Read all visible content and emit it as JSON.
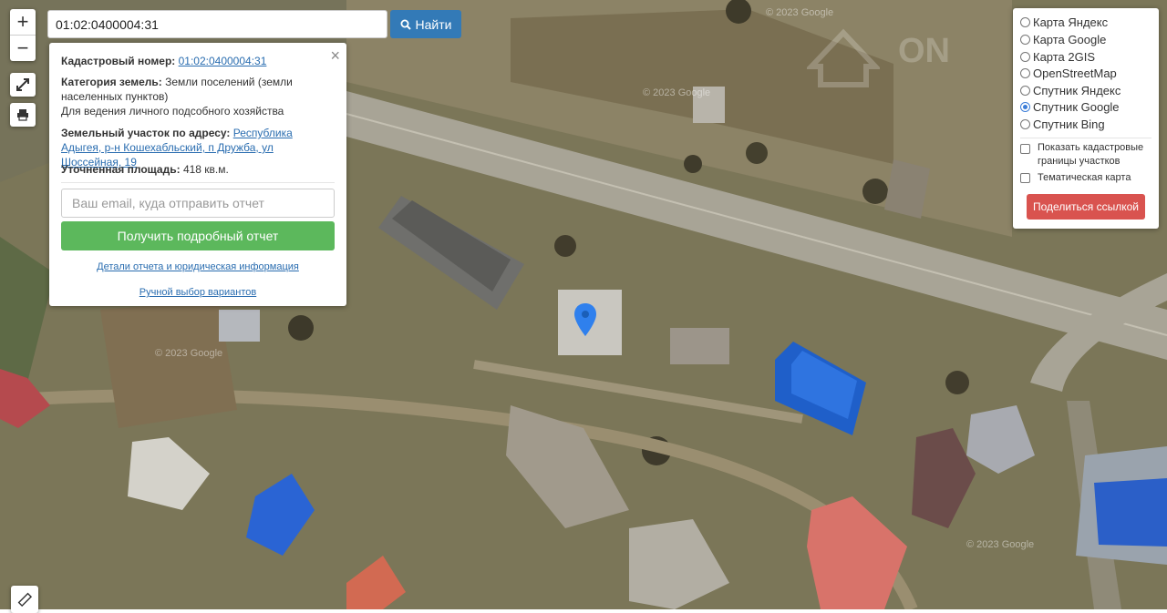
{
  "search": {
    "value": "01:02:0400004:31",
    "button_label": "Найти"
  },
  "map_controls": {
    "zoom_in": "+",
    "zoom_out": "−"
  },
  "info": {
    "cadastral_label": "Кадастровый номер:",
    "cadastral_value": "01:02:0400004:31",
    "category_label": "Категория земель:",
    "category_value": "Земли поселений (земли населенных пунктов)",
    "usage": "Для ведения личного подсобного хозяйства",
    "address_label": "Земельный участок по адресу:",
    "address_value": "Республика Адыгея, р-н Кошехабльский, п Дружба, ул Шоссейная, 19",
    "area_label": "Уточненная площадь:",
    "area_value": "418 кв.м.",
    "email_placeholder": "Ваш email, куда отправить отчет",
    "report_button": "Получить подробный отчет",
    "details_link": "Детали отчета и юридическая информация",
    "manual_link": "Ручной выбор вариантов",
    "close": "×"
  },
  "layers": {
    "options": [
      {
        "label": "Карта Яндекс",
        "selected": false
      },
      {
        "label": "Карта Google",
        "selected": false
      },
      {
        "label": "Карта 2GIS",
        "selected": false
      },
      {
        "label": "OpenStreetMap",
        "selected": false
      },
      {
        "label": "Спутник Яндекс",
        "selected": false
      },
      {
        "label": "Спутник Google",
        "selected": true
      },
      {
        "label": "Спутник Bing",
        "selected": false
      }
    ],
    "show_cadastral": "Показать кадастровые границы участков",
    "thematic": "Тематическая карта",
    "share_button": "Поделиться ссылкой"
  },
  "watermarks": {
    "google": "© 2023 Google",
    "brand": "ON"
  },
  "colors": {
    "search_button": "#337ab7",
    "report_button": "#5cb85c",
    "share_button": "#d9534f",
    "marker": "#2f80ed"
  }
}
